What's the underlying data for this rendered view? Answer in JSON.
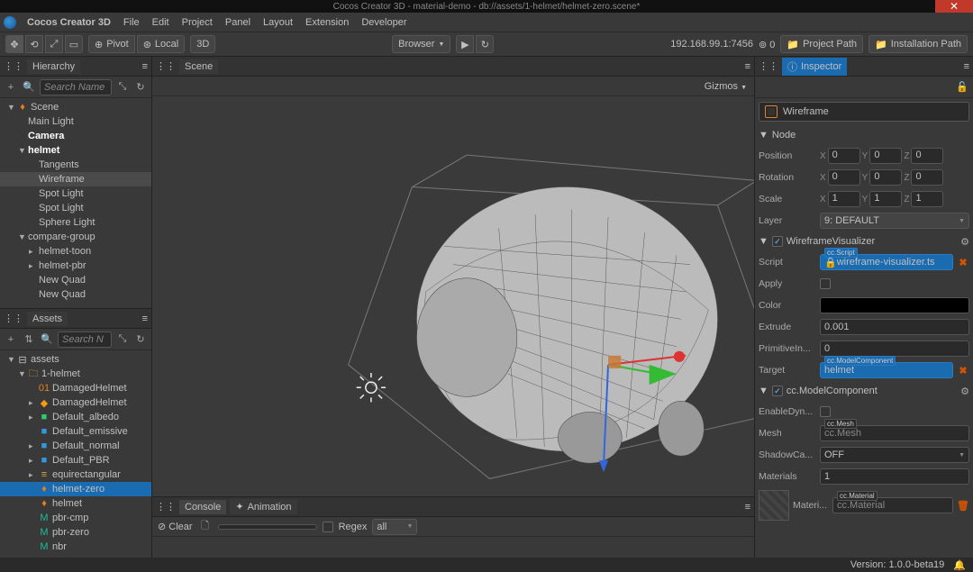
{
  "app": {
    "title": "Cocos Creator 3D - material-demo - db://assets/1-helmet/helmet-zero.scene*",
    "name": "Cocos Creator 3D"
  },
  "menus": [
    "File",
    "Edit",
    "Project",
    "Panel",
    "Layout",
    "Extension",
    "Developer"
  ],
  "toolbar": {
    "pivot": "Pivot",
    "local": "Local",
    "mode3d": "3D",
    "browser": "Browser",
    "ip": "192.168.99.1:7456",
    "projectPath": "Project Path",
    "installationPath": "Installation Path"
  },
  "hierarchy": {
    "title": "Hierarchy",
    "searchPlaceholder": "Search Name",
    "nodes": [
      {
        "label": "Scene",
        "type": "flame",
        "indent": 0,
        "arrow": "▼"
      },
      {
        "label": "Main Light",
        "indent": 1
      },
      {
        "label": "Camera",
        "indent": 1,
        "bold": true
      },
      {
        "label": "helmet",
        "indent": 1,
        "arrow": "▼",
        "bold": true
      },
      {
        "label": "Tangents",
        "indent": 2
      },
      {
        "label": "Wireframe",
        "indent": 2,
        "selected": true
      },
      {
        "label": "Spot Light",
        "indent": 2
      },
      {
        "label": "Spot Light",
        "indent": 2
      },
      {
        "label": "Sphere Light",
        "indent": 2
      },
      {
        "label": "compare-group",
        "indent": 1,
        "arrow": "▼"
      },
      {
        "label": "helmet-toon",
        "indent": 2,
        "arrow": "▸"
      },
      {
        "label": "helmet-pbr",
        "indent": 2,
        "arrow": "▸"
      },
      {
        "label": "New Quad",
        "indent": 2
      },
      {
        "label": "New Quad",
        "indent": 2
      }
    ]
  },
  "assets": {
    "title": "Assets",
    "searchPlaceholder": "Search N",
    "items": [
      {
        "label": "assets",
        "type": "db",
        "indent": 0,
        "arrow": "▼"
      },
      {
        "label": "1-helmet",
        "type": "folder",
        "indent": 1,
        "arrow": "▼"
      },
      {
        "label": "DamagedHelmet",
        "prefix": "01",
        "type": "01",
        "indent": 2
      },
      {
        "label": "DamagedHelmet",
        "type": "cube-o",
        "indent": 2,
        "arrow": "▸"
      },
      {
        "label": "Default_albedo",
        "type": "cube-g",
        "indent": 2,
        "arrow": "▸"
      },
      {
        "label": "Default_emissive",
        "type": "cube-b",
        "indent": 2
      },
      {
        "label": "Default_normal",
        "type": "cube-b",
        "indent": 2,
        "arrow": "▸"
      },
      {
        "label": "Default_PBR",
        "type": "cube-b",
        "indent": 2,
        "arrow": "▸"
      },
      {
        "label": "equirectangular",
        "type": "bars",
        "indent": 2,
        "arrow": "▸"
      },
      {
        "label": "helmet-zero",
        "type": "flame",
        "indent": 2,
        "selected": true
      },
      {
        "label": "helmet",
        "type": "flame",
        "indent": 2
      },
      {
        "label": "pbr-cmp",
        "type": "M",
        "indent": 2
      },
      {
        "label": "pbr-zero",
        "type": "M",
        "indent": 2
      },
      {
        "label": "nbr",
        "type": "M",
        "indent": 2
      }
    ]
  },
  "scene": {
    "title": "Scene",
    "gizmos": "Gizmos"
  },
  "console": {
    "tabConsole": "Console",
    "tabAnimation": "Animation",
    "clear": "Clear",
    "regex": "Regex",
    "filter": "all"
  },
  "inspector": {
    "title": "Inspector",
    "nodeName": "Wireframe",
    "nodeSection": "Node",
    "posLabel": "Position",
    "pos": {
      "x": "0",
      "y": "0",
      "z": "0"
    },
    "rotLabel": "Rotation",
    "rot": {
      "x": "0",
      "y": "0",
      "z": "0"
    },
    "scaleLabel": "Scale",
    "scale": {
      "x": "1",
      "y": "1",
      "z": "1"
    },
    "layerLabel": "Layer",
    "layer": "9: DEFAULT",
    "wireframe": {
      "title": "WireframeVisualizer",
      "scriptLabel": "Script",
      "scriptType": "cc.Script",
      "scriptValue": "wireframe-visualizer.ts",
      "applyLabel": "Apply",
      "colorLabel": "Color",
      "extrudeLabel": "Extrude",
      "extrudeValue": "0.001",
      "primIndexLabel": "PrimitiveIn...",
      "primIndexValue": "0",
      "targetLabel": "Target",
      "targetType": "cc.ModelComponent",
      "targetValue": "helmet"
    },
    "model": {
      "title": "cc.ModelComponent",
      "enableDynLabel": "EnableDyn...",
      "meshLabel": "Mesh",
      "meshType": "cc.Mesh",
      "meshValue": "cc.Mesh",
      "shadowLabel": "ShadowCa...",
      "shadowValue": "OFF",
      "materialsLabel": "Materials",
      "materialsValue": "1",
      "materialItemLabel": "Materi...",
      "materialType": "cc.Material",
      "materialValue": "cc.Material"
    }
  },
  "status": {
    "version": "Version: 1.0.0-beta19"
  }
}
